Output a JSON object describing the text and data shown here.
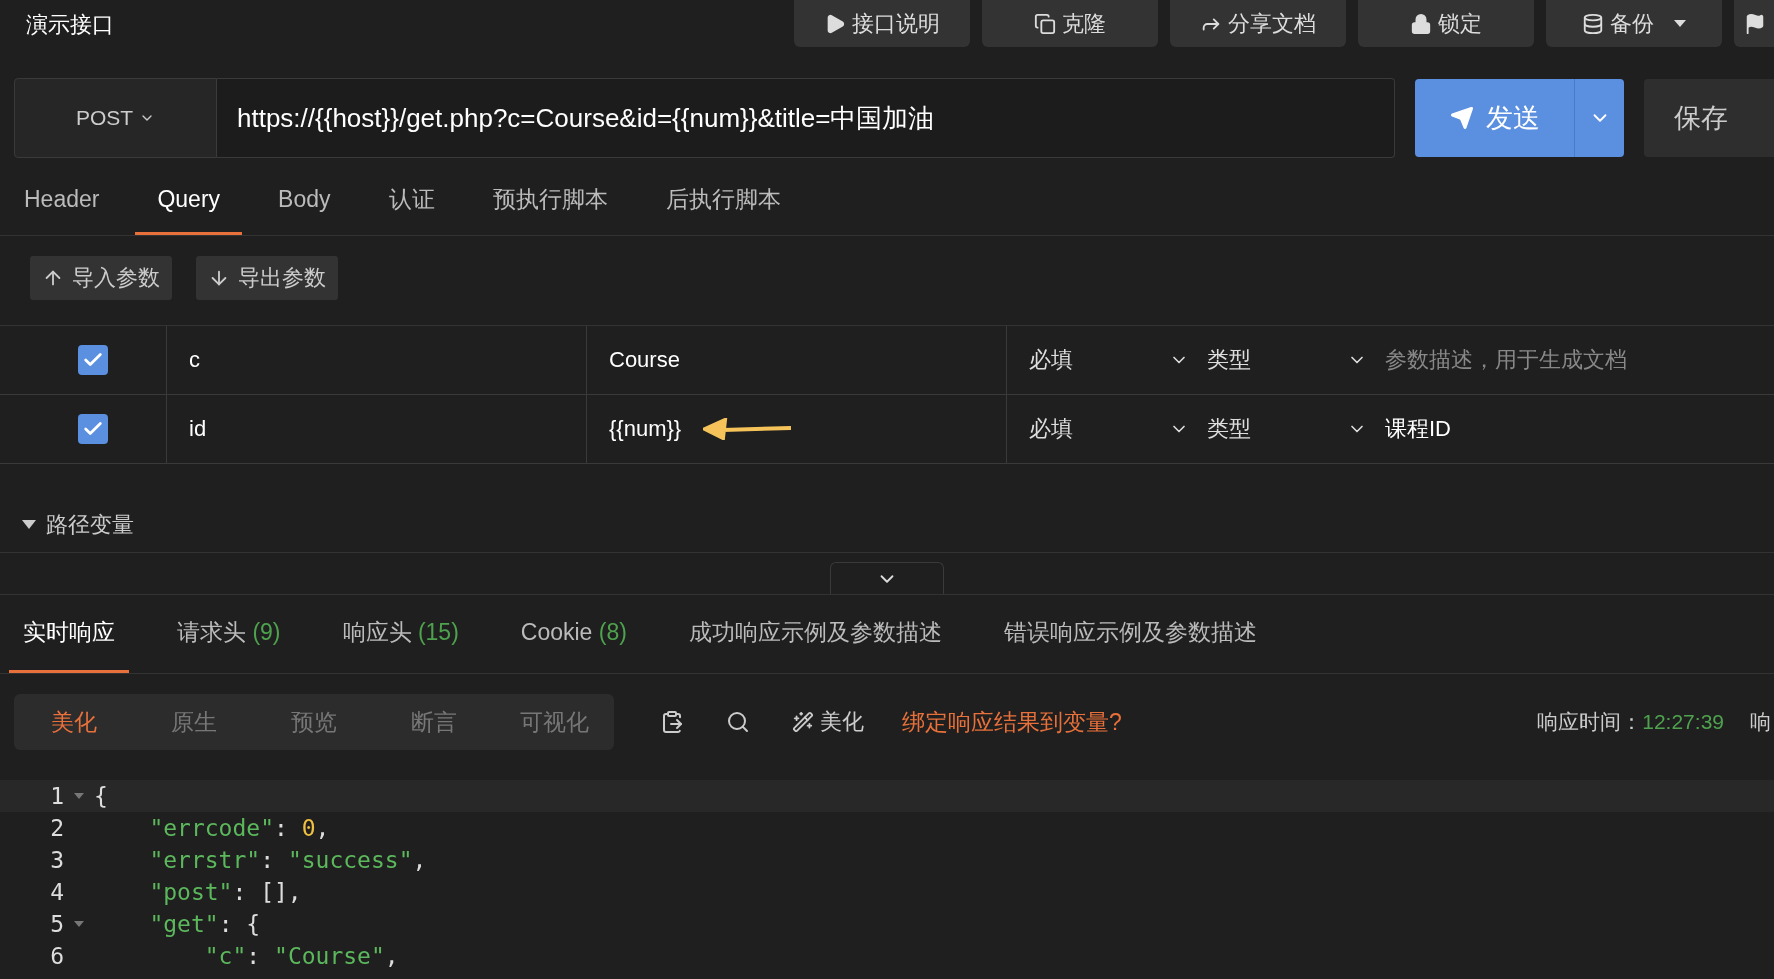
{
  "title": "演示接口",
  "top_buttons": [
    {
      "label": "接口说明",
      "dropdown": false
    },
    {
      "label": "克隆",
      "dropdown": false
    },
    {
      "label": "分享文档",
      "dropdown": false
    },
    {
      "label": "锁定",
      "dropdown": false
    },
    {
      "label": "备份",
      "dropdown": true
    }
  ],
  "request": {
    "method": "POST",
    "url": "https://{{host}}/get.php?c=Course&id={{num}}&title=中国加油",
    "send": "发送",
    "save": "保存"
  },
  "request_tabs": [
    {
      "label": "Header",
      "selected": false
    },
    {
      "label": "Query",
      "selected": true
    },
    {
      "label": "Body",
      "selected": false
    },
    {
      "label": "认证",
      "selected": false
    },
    {
      "label": "预执行脚本",
      "selected": false
    },
    {
      "label": "后执行脚本",
      "selected": false
    }
  ],
  "param_actions": [
    {
      "label": "导入参数"
    },
    {
      "label": "导出参数"
    }
  ],
  "params": [
    {
      "checked": true,
      "key": "c",
      "value": "Course",
      "required": "必填",
      "type": "类型",
      "placeholder": "参数描述，用于生成文档",
      "arrow": false
    },
    {
      "checked": true,
      "key": "id",
      "value": "{{num}}",
      "required": "必填",
      "type": "类型",
      "description": "课程ID",
      "arrow": true
    }
  ],
  "path_variables": {
    "label": "路径变量",
    "expanded": true
  },
  "response_tabs": [
    {
      "label": "实时响应",
      "selected": true
    },
    {
      "label": "请求头",
      "count": "(9)",
      "selected": false
    },
    {
      "label": "响应头",
      "count": "(15)",
      "selected": false
    },
    {
      "label": "Cookie",
      "count": "(8)",
      "selected": false
    },
    {
      "label": "成功响应示例及参数描述",
      "selected": false
    },
    {
      "label": "错误响应示例及参数描述",
      "selected": false
    }
  ],
  "view_modes": [
    {
      "label": "美化",
      "selected": true
    },
    {
      "label": "原生",
      "selected": false
    },
    {
      "label": "预览",
      "selected": false
    },
    {
      "label": "断言",
      "selected": false
    },
    {
      "label": "可视化",
      "selected": false
    }
  ],
  "beautify": "美化",
  "bind_link": "绑定响应结果到变量?",
  "time_label": "响应时间：",
  "time_value": "12:27:39",
  "cut_label": "响",
  "code_lines": [
    {
      "number": "1",
      "fold": true,
      "tokens": [
        {
          "kind": "punct",
          "text": "{"
        }
      ]
    },
    {
      "number": "2",
      "fold": false,
      "tokens": [
        {
          "kind": "key",
          "text": "    \"errcode\""
        },
        {
          "kind": "punct",
          "text": ": "
        },
        {
          "kind": "number",
          "text": "0"
        },
        {
          "kind": "punct",
          "text": ","
        }
      ]
    },
    {
      "number": "3",
      "fold": false,
      "tokens": [
        {
          "kind": "key",
          "text": "    \"errstr\""
        },
        {
          "kind": "punct",
          "text": ": "
        },
        {
          "kind": "string",
          "text": "\"success\""
        },
        {
          "kind": "punct",
          "text": ","
        }
      ]
    },
    {
      "number": "4",
      "fold": false,
      "tokens": [
        {
          "kind": "key",
          "text": "    \"post\""
        },
        {
          "kind": "punct",
          "text": ": [],"
        }
      ]
    },
    {
      "number": "5",
      "fold": true,
      "tokens": [
        {
          "kind": "key",
          "text": "    \"get\""
        },
        {
          "kind": "punct",
          "text": ": {"
        }
      ]
    },
    {
      "number": "6",
      "fold": false,
      "tokens": [
        {
          "kind": "key",
          "text": "        \"c\""
        },
        {
          "kind": "punct",
          "text": ": "
        },
        {
          "kind": "string",
          "text": "\"Course\""
        },
        {
          "kind": "punct",
          "text": ","
        }
      ]
    }
  ]
}
